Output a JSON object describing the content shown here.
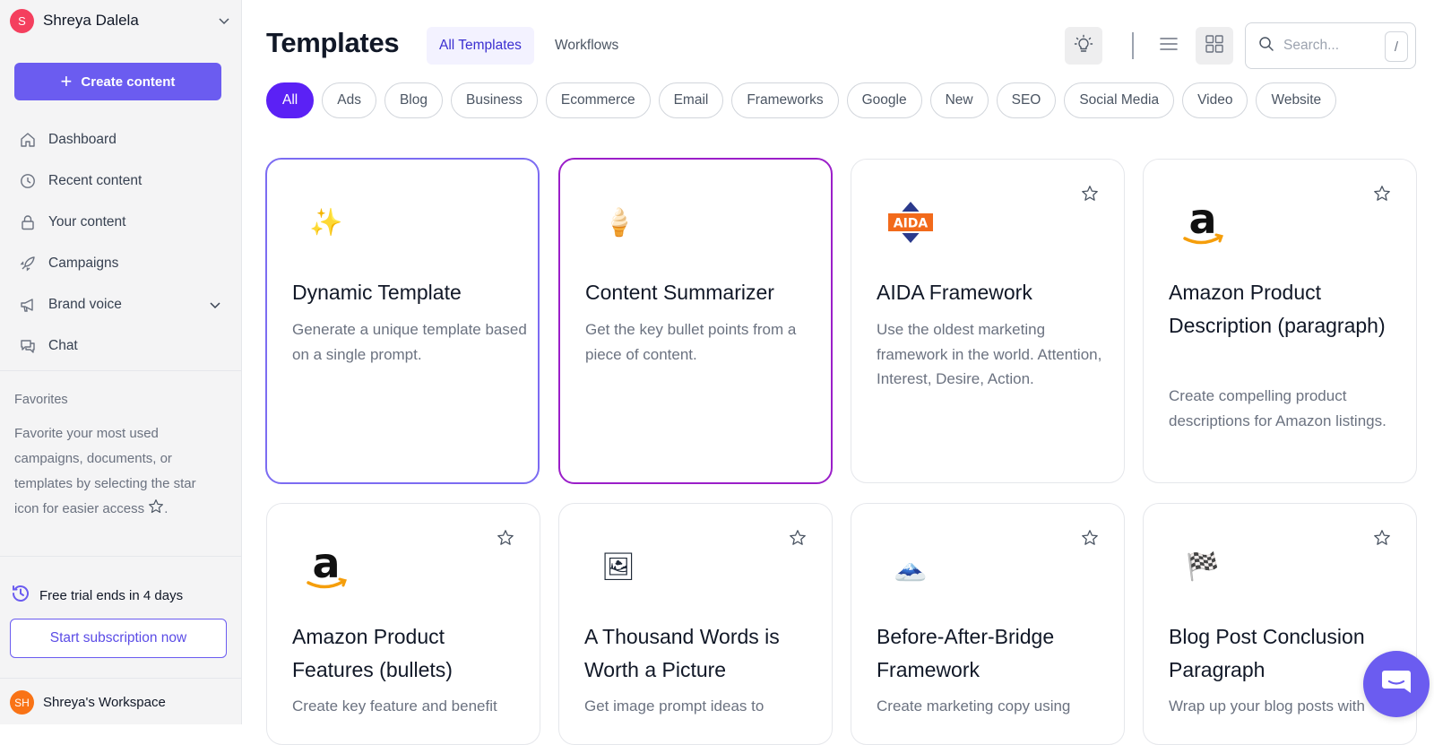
{
  "user": {
    "initial": "S",
    "name": "Shreya Dalela"
  },
  "sidebar": {
    "create_label": "Create content",
    "nav": [
      {
        "label": "Dashboard"
      },
      {
        "label": "Recent content"
      },
      {
        "label": "Your content"
      },
      {
        "label": "Campaigns"
      },
      {
        "label": "Brand voice"
      },
      {
        "label": "Chat"
      }
    ],
    "favorites_title": "Favorites",
    "favorites_text": "Favorite your most used campaigns, documents, or templates by selecting the star icon for easier access",
    "favorites_end": ".",
    "trial_text": "Free trial ends in 4 days",
    "subscribe_label": "Start subscription now",
    "workspace_initials": "SH",
    "workspace_name": "Shreya's Workspace"
  },
  "header": {
    "title": "Templates",
    "tabs": [
      {
        "label": "All Templates"
      },
      {
        "label": "Workflows"
      }
    ],
    "search_placeholder": "Search...",
    "search_shortcut": "/"
  },
  "chips": [
    "All",
    "Ads",
    "Blog",
    "Business",
    "Ecommerce",
    "Email",
    "Frameworks",
    "Google",
    "New",
    "SEO",
    "Social Media",
    "Video",
    "Website"
  ],
  "cards": [
    {
      "title": "Dynamic Template",
      "desc": "Generate a unique template based on a single prompt.",
      "icon": "sparkles-icon",
      "glyph": "✨"
    },
    {
      "title": "Content Summarizer",
      "desc": "Get the key bullet points from a piece of content.",
      "icon": "ice-cream-icon",
      "glyph": "🍦"
    },
    {
      "title": "AIDA Framework",
      "desc": "Use the oldest marketing framework in the world. Attention, Interest, Desire, Action.",
      "icon": "aida-logo-icon",
      "badge": "AIDA"
    },
    {
      "title": "Amazon Product Description (paragraph)",
      "desc": "Create compelling product descriptions for Amazon listings.",
      "icon": "amazon-logo-icon",
      "glyph": "a"
    },
    {
      "title": "Amazon Product Features (bullets)",
      "desc": "Create key feature and benefit",
      "icon": "amazon-logo-icon",
      "glyph": "a"
    },
    {
      "title": "A Thousand Words is Worth a Picture",
      "desc": "Get image prompt ideas to",
      "icon": "framed-picture-icon",
      "glyph": "🖼"
    },
    {
      "title": "Before-After-Bridge Framework",
      "desc": "Create marketing copy using",
      "icon": "mountain-picture-icon",
      "glyph": "🗻"
    },
    {
      "title": "Blog Post Conclusion Paragraph",
      "desc": "Wrap up your blog posts with",
      "icon": "checkered-flag-icon",
      "glyph": "🏁"
    }
  ],
  "colors": {
    "accent": "#6b5cf0",
    "chip_active": "#5b21f5",
    "selected_border_1": "#7c6cf2",
    "selected_border_2": "#9b1fc9"
  }
}
